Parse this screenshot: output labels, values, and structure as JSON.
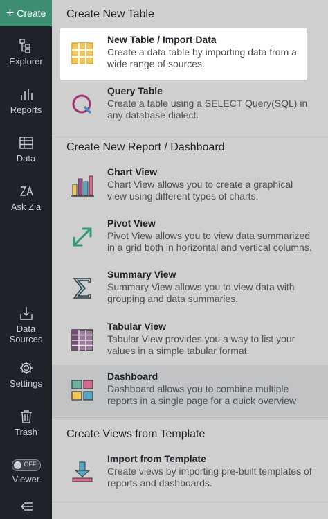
{
  "sidebar": {
    "create_label": "Create",
    "items": [
      {
        "label": "Explorer",
        "icon": "explorer-icon"
      },
      {
        "label": "Reports",
        "icon": "reports-icon"
      },
      {
        "label": "Data",
        "icon": "data-icon"
      },
      {
        "label": "Ask Zia",
        "icon": "zia-icon"
      },
      {
        "label": "Data Sources",
        "icon": "data-sources-icon"
      },
      {
        "label": "Settings",
        "icon": "settings-icon"
      },
      {
        "label": "Trash",
        "icon": "trash-icon"
      },
      {
        "label": "Viewer",
        "toggle_text": "OFF"
      }
    ]
  },
  "sections": [
    {
      "title": "Create New Table",
      "items": [
        {
          "title": "New Table / Import Data",
          "desc": "Create a data table by importing data from a wide range of sources.",
          "icon": "table-grid-icon"
        },
        {
          "title": "Query Table",
          "desc": "Create a table using a SELECT Query(SQL) in any database dialect.",
          "icon": "query-icon"
        }
      ]
    },
    {
      "title": "Create New Report / Dashboard",
      "items": [
        {
          "title": "Chart View",
          "desc": "Chart View allows you to create a graphical view using different types of charts.",
          "icon": "bar-chart-icon"
        },
        {
          "title": "Pivot View",
          "desc": "Pivot View allows you to view data summarized in a grid both in horizontal and vertical columns.",
          "icon": "pivot-arrows-icon"
        },
        {
          "title": "Summary View",
          "desc": "Summary View allows you to view data with grouping and data summaries.",
          "icon": "sigma-icon"
        },
        {
          "title": "Tabular View",
          "desc": "Tabular View provides you a way to list your values in a simple tabular format.",
          "icon": "tabular-icon"
        },
        {
          "title": "Dashboard",
          "desc": "Dashboard allows you to combine multiple reports in a single page for a quick overview",
          "icon": "dashboard-icon"
        }
      ]
    },
    {
      "title": "Create Views from Template",
      "items": [
        {
          "title": "Import from Template",
          "desc": "Create views by importing pre-built templates of reports and dashboards.",
          "icon": "download-icon"
        }
      ]
    }
  ]
}
